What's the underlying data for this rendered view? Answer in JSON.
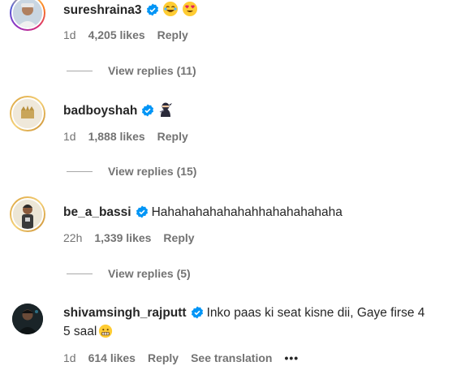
{
  "comments": [
    {
      "username": "sureshraina3",
      "verified_icon": "verified-badge-icon",
      "text": "",
      "emojis": [
        "laughing-emoji-icon",
        "heart-eyes-emoji-icon"
      ],
      "time": "1d",
      "likes": "4,205 likes",
      "reply_label": "Reply",
      "view_replies": "View replies (11)"
    },
    {
      "username": "badboyshah",
      "verified_icon": "verified-badge-icon",
      "text": "",
      "emojis": [
        "ninja-emoji-icon"
      ],
      "time": "1d",
      "likes": "1,888 likes",
      "reply_label": "Reply",
      "view_replies": "View replies (15)"
    },
    {
      "username": "be_a_bassi",
      "verified_icon": "verified-badge-icon",
      "text": "Hahahahahahahahhahahahahaha",
      "time": "22h",
      "likes": "1,339 likes",
      "reply_label": "Reply",
      "view_replies": "View replies (5)"
    },
    {
      "username": "shivamsingh_rajputt",
      "verified_icon": "verified-badge-icon",
      "text_line1": "Inko paas ki seat kisne dii, Gaye firse 4",
      "text_line2": "5 saal",
      "emojis": [
        "grimacing-emoji-icon"
      ],
      "time": "1d",
      "likes": "614 likes",
      "reply_label": "Reply",
      "see_translation": "See translation",
      "more_label": "•••"
    }
  ],
  "colors": {
    "text": "#262626",
    "secondary": "#737373",
    "verified": "#0095f6"
  }
}
